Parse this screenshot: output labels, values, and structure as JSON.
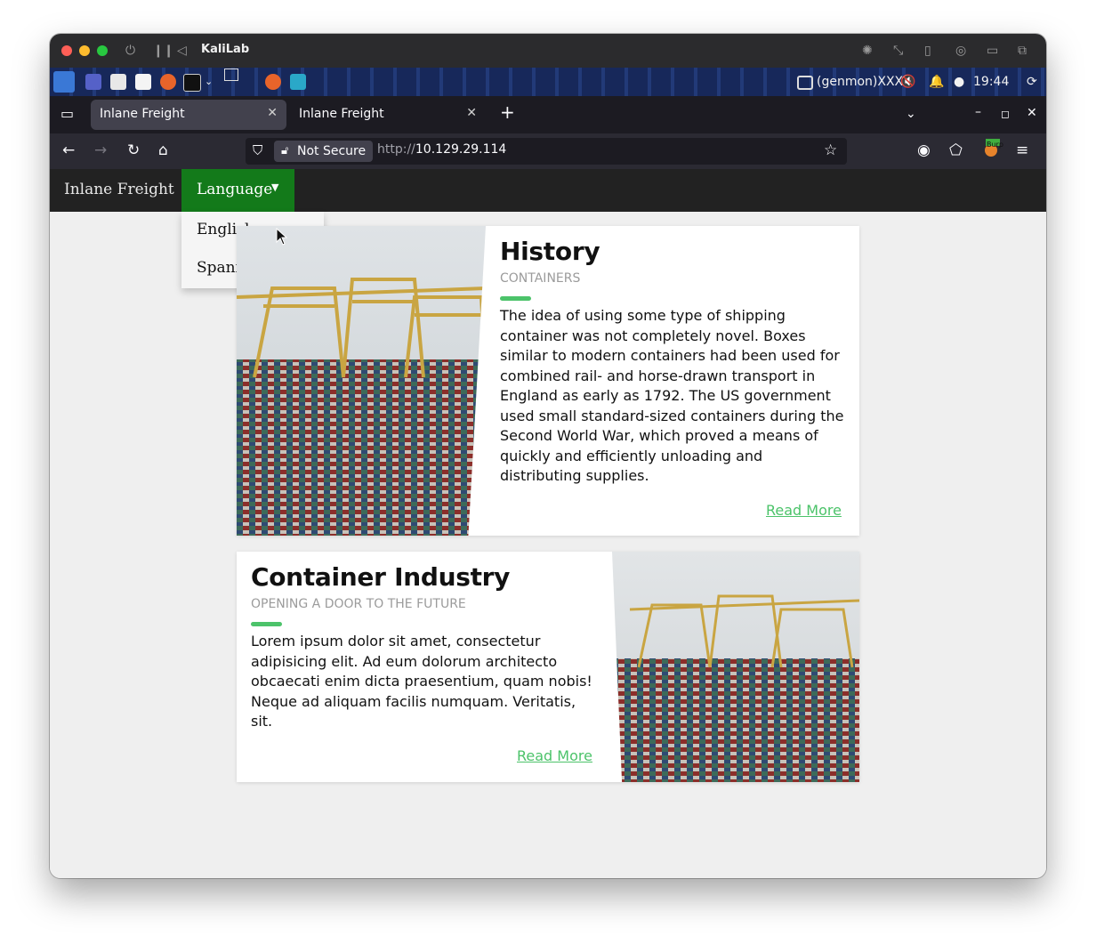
{
  "vm": {
    "title": "KaliLab"
  },
  "panel": {
    "genmon": "(genmon)XXX",
    "clock": "19:44",
    "burp_badge": "Burp"
  },
  "browser": {
    "tabs": [
      {
        "label": "Inlane Freight",
        "active": true
      },
      {
        "label": "Inlane Freight",
        "active": false
      }
    ],
    "new_tab": "+",
    "security_label": "Not Secure",
    "url_scheme": "http://",
    "url_host": "10.129.29.114"
  },
  "site": {
    "brand": "Inlane Freight",
    "language_button": "Language",
    "language_options": [
      "English",
      "Spanish"
    ],
    "nav_color": "#222222",
    "active_color": "#137a1a",
    "accent_color": "#4cc36a"
  },
  "cards": [
    {
      "title": "History",
      "subtitle": "CONTAINERS",
      "lines": [
        "The idea of using some type of shipping",
        "container was not completely novel. Boxes",
        "similar to modern containers had been used for",
        "combined rail- and horse-drawn transport in",
        "England as early as 1792. The US government",
        "used small standard-sized containers during the",
        "Second World War, which proved a means of",
        "quickly and efficiently unloading and",
        "distributing supplies."
      ],
      "read_more": "Read More"
    },
    {
      "title": "Container Industry",
      "subtitle": "OPENING A DOOR TO THE FUTURE",
      "lines": [
        "Lorem ipsum dolor sit amet, consectetur",
        "adipisicing elit. Ad eum dolorum architecto",
        "obcaecati enim dicta praesentium, quam nobis!",
        "Neque ad aliquam facilis numquam. Veritatis,",
        "sit."
      ],
      "read_more": "Read More"
    }
  ]
}
